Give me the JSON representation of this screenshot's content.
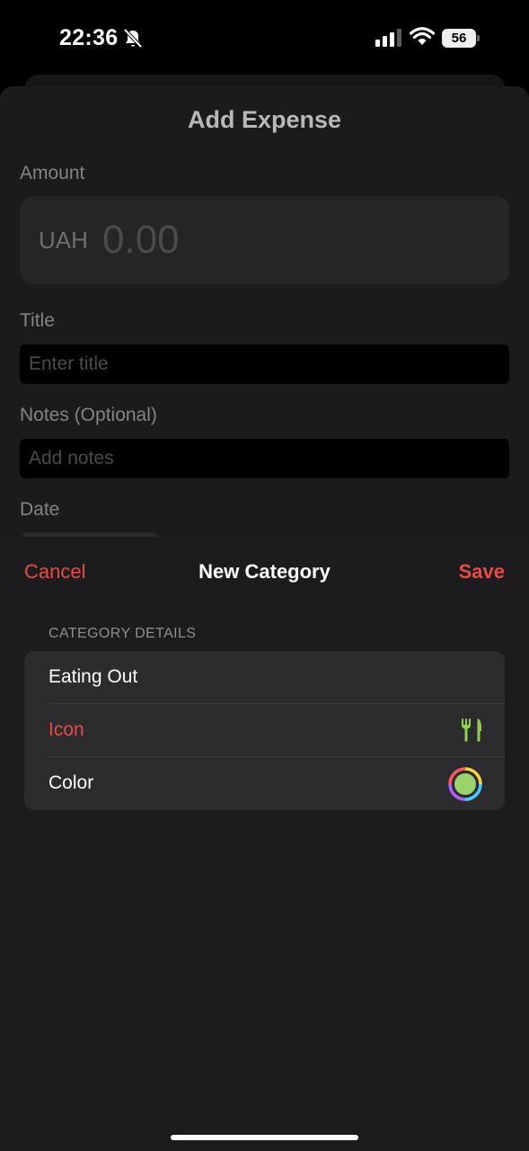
{
  "status_bar": {
    "time": "22:36",
    "battery": "56",
    "icons": [
      "bell-slash-icon",
      "signal-icon",
      "wifi-icon",
      "battery-icon"
    ]
  },
  "expense_form": {
    "title": "Add Expense",
    "amount_label": "Amount",
    "currency": "UAH",
    "amount_placeholder": "0.00",
    "title_label": "Title",
    "title_placeholder": "Enter title",
    "notes_label": "Notes (Optional)",
    "notes_placeholder": "Add notes",
    "date_label": "Date"
  },
  "category_sheet": {
    "cancel_label": "Cancel",
    "title": "New Category",
    "save_label": "Save",
    "section_header": "CATEGORY DETAILS",
    "name_value": "Eating Out",
    "icon_label": "Icon",
    "icon_name": "fork-knife-icon",
    "color_label": "Color",
    "selected_color": "#9bd46a"
  },
  "colors": {
    "accent": "#ea4a44",
    "icon_green": "#8fd14f"
  }
}
